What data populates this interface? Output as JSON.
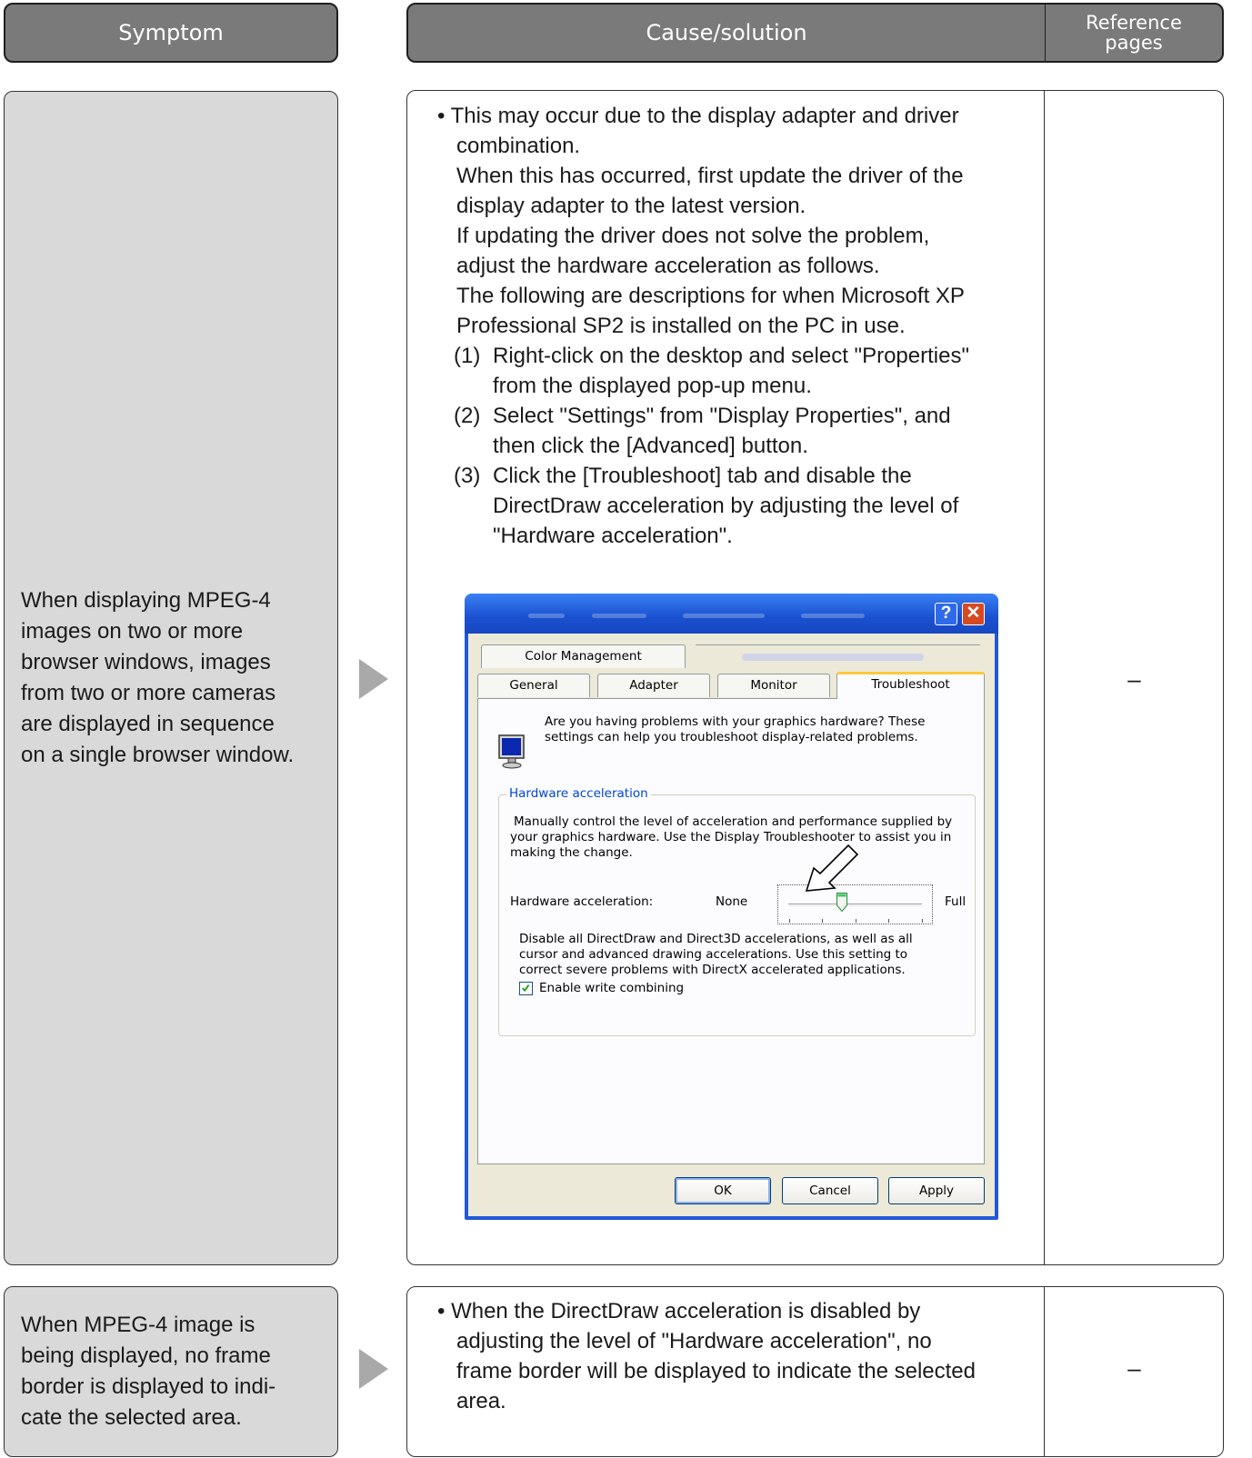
{
  "headers": {
    "symptom": "Symptom",
    "cause": "Cause/solution",
    "reference_line1": "Reference",
    "reference_line2": "pages"
  },
  "rows": [
    {
      "symptom_lines": [
        "When displaying MPEG-4",
        "images on two or more",
        "browser windows, images",
        "from two or more cameras",
        "are displayed in sequence",
        "on a single browser window."
      ],
      "cause_lines": [
        "• This may occur due to the display adapter and driver",
        "combination.",
        "When this has occurred, first update the driver of the",
        "display adapter to the latest version.",
        "If updating the driver does not solve the problem,",
        "adjust the hardware acceleration as follows.",
        "The following are descriptions for when Microsoft XP",
        "Professional SP2 is installed on the PC in use."
      ],
      "steps": [
        {
          "num": "(1)",
          "lines": [
            "Right-click on the desktop and select \"Properties\"",
            "from the displayed pop-up menu."
          ]
        },
        {
          "num": "(2)",
          "lines": [
            "Select \"Settings\" from \"Display Properties\", and",
            "then click the [Advanced] button."
          ]
        },
        {
          "num": "(3)",
          "lines": [
            "Click the [Troubleshoot] tab and disable the",
            "DirectDraw acceleration by adjusting the level of",
            "\"Hardware acceleration\"."
          ]
        }
      ],
      "reference": "–"
    },
    {
      "symptom_lines": [
        "When MPEG-4 image is",
        "being displayed, no frame",
        "border is displayed to indi-",
        "cate the selected area."
      ],
      "cause_lines": [
        "• When the DirectDraw acceleration is disabled by",
        "adjusting the level of \"Hardware acceleration\", no",
        "frame border will be displayed to indicate the selected",
        "area."
      ],
      "reference": "–"
    }
  ],
  "dialog": {
    "title_buttons": {
      "help": "?",
      "close": "✕"
    },
    "tabs": {
      "color_management": "Color Management",
      "general": "General",
      "adapter": "Adapter",
      "monitor": "Monitor",
      "troubleshoot": "Troubleshoot"
    },
    "intro_lines": [
      "Are you having problems with your graphics hardware? These",
      "settings can help you troubleshoot display-related problems."
    ],
    "group_label": "Hardware acceleration",
    "group_desc_lines": [
      "Manually control the level of acceleration and performance supplied by",
      "your graphics hardware. Use the Display Troubleshooter to assist you in",
      "making the change."
    ],
    "slider_label": "Hardware acceleration:",
    "slider_min": "None",
    "slider_max": "Full",
    "slider_level_fraction": 0.4,
    "level_desc_lines": [
      "Disable all DirectDraw and Direct3D accelerations, as well as all",
      "cursor and advanced drawing accelerations. Use this setting to",
      "correct severe problems with DirectX accelerated applications."
    ],
    "checkbox_label": "Enable write combining",
    "checkbox_checked": true,
    "buttons": {
      "ok": "OK",
      "cancel": "Cancel",
      "apply": "Apply"
    }
  },
  "colors": {
    "header_bg": "#7a7a7a",
    "symptom_bg": "#d9d9d9",
    "arrow": "#a9a9a9",
    "xp_title_blue": "#2058d8"
  }
}
